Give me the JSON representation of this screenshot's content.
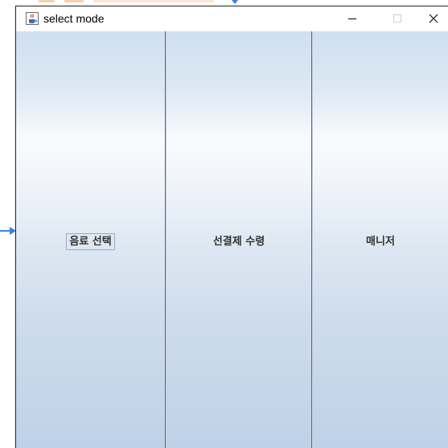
{
  "window": {
    "title": "select mode",
    "app_icon": "java-cup-icon",
    "controls": [
      "minimize",
      "maximize",
      "close"
    ]
  },
  "modes": {
    "items": [
      {
        "label": "음료 선택",
        "focused": true
      },
      {
        "label": "선결제 수령",
        "focused": false
      },
      {
        "label": "매니저",
        "focused": false
      }
    ]
  },
  "colors": {
    "accent_arrow": "#3b82d6",
    "button_gradient_top": "#cfdff0",
    "button_gradient_bottom": "#bfd1e7",
    "divider": "#5a6676"
  }
}
